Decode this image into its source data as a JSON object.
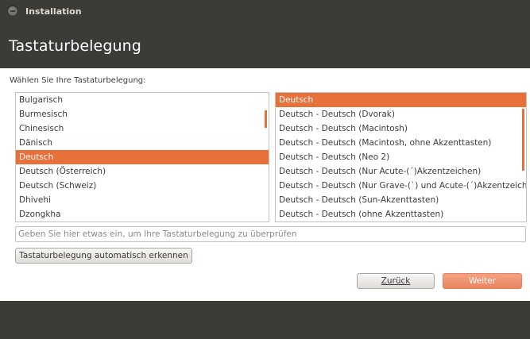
{
  "window": {
    "title": "Installation"
  },
  "header": {
    "title": "Tastaturbelegung"
  },
  "prompt": "Wählen Sie Ihre Tastaturbelegung:",
  "layouts": [
    "Bulgarisch",
    "Burmesisch",
    "Chinesisch",
    "Dänisch",
    "Deutsch",
    "Deutsch (Österreich)",
    "Deutsch (Schweiz)",
    "Dhivehi",
    "Dzongkha"
  ],
  "layouts_selected_index": 4,
  "variants": [
    "Deutsch",
    "Deutsch - Deutsch (Dvorak)",
    "Deutsch - Deutsch (Macintosh)",
    "Deutsch - Deutsch (Macintosh, ohne Akzenttasten)",
    "Deutsch - Deutsch (Neo 2)",
    "Deutsch - Deutsch (Nur Acute-(´)Akzentzeichen)",
    "Deutsch - Deutsch (Nur Grave-(`) und Acute-(´)Akzentzeiche",
    "Deutsch - Deutsch (Sun-Akzenttasten)",
    "Deutsch - Deutsch (ohne Akzenttasten)"
  ],
  "variants_selected_index": 0,
  "test_input": {
    "placeholder": "Geben Sie hier etwas ein, um Ihre Tastaturbelegung zu überprüfen",
    "value": ""
  },
  "buttons": {
    "detect": "Tastaturbelegung automatisch erkennen",
    "back": "Zurück",
    "next": "Weiter"
  },
  "colors": {
    "accent": "#e8703a",
    "chrome": "#3c3b37"
  }
}
